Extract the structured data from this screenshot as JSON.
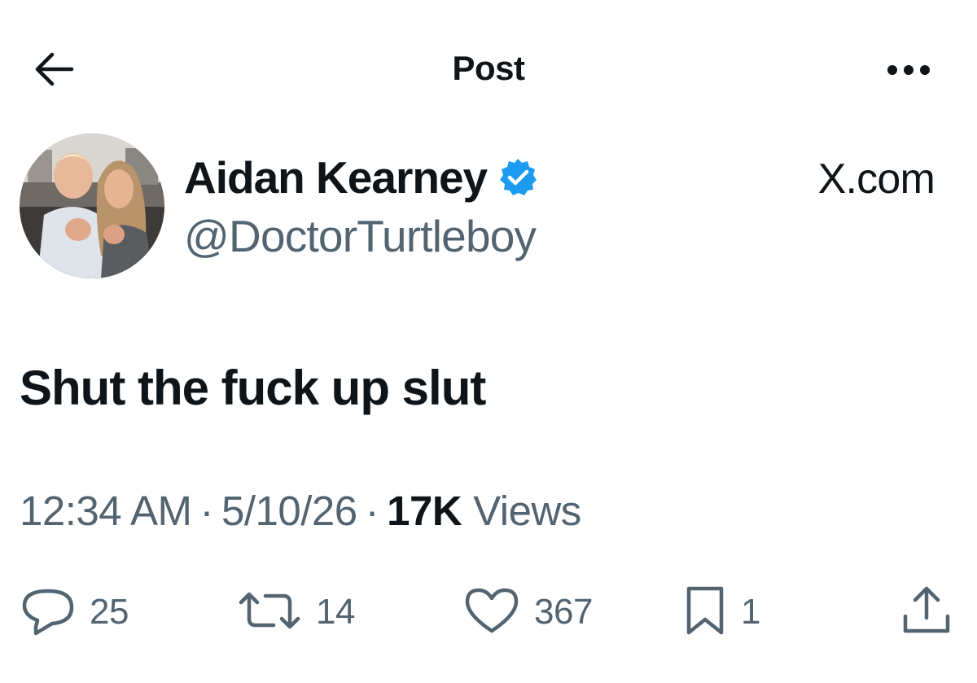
{
  "header": {
    "title": "Post",
    "back_icon": "arrow-left-icon",
    "more_icon": "ellipsis-icon"
  },
  "author": {
    "name": "Aidan Kearney",
    "handle": "@DoctorTurtleboy",
    "verified_icon": "verified-badge-icon",
    "verified_color": "#1d9bf0"
  },
  "source_label": "X.com",
  "tweet": {
    "text": "Shut the fuck up slut"
  },
  "meta": {
    "time": "12:34 AM",
    "separator": "·",
    "date": "5/10/26",
    "views_count": "17K",
    "views_label": "Views"
  },
  "actions": {
    "reply_count": "25",
    "repost_count": "14",
    "like_count": "367",
    "bookmark_count": "1"
  },
  "colors": {
    "text_primary": "#0f1419",
    "text_secondary": "#536471",
    "accent": "#1d9bf0"
  }
}
